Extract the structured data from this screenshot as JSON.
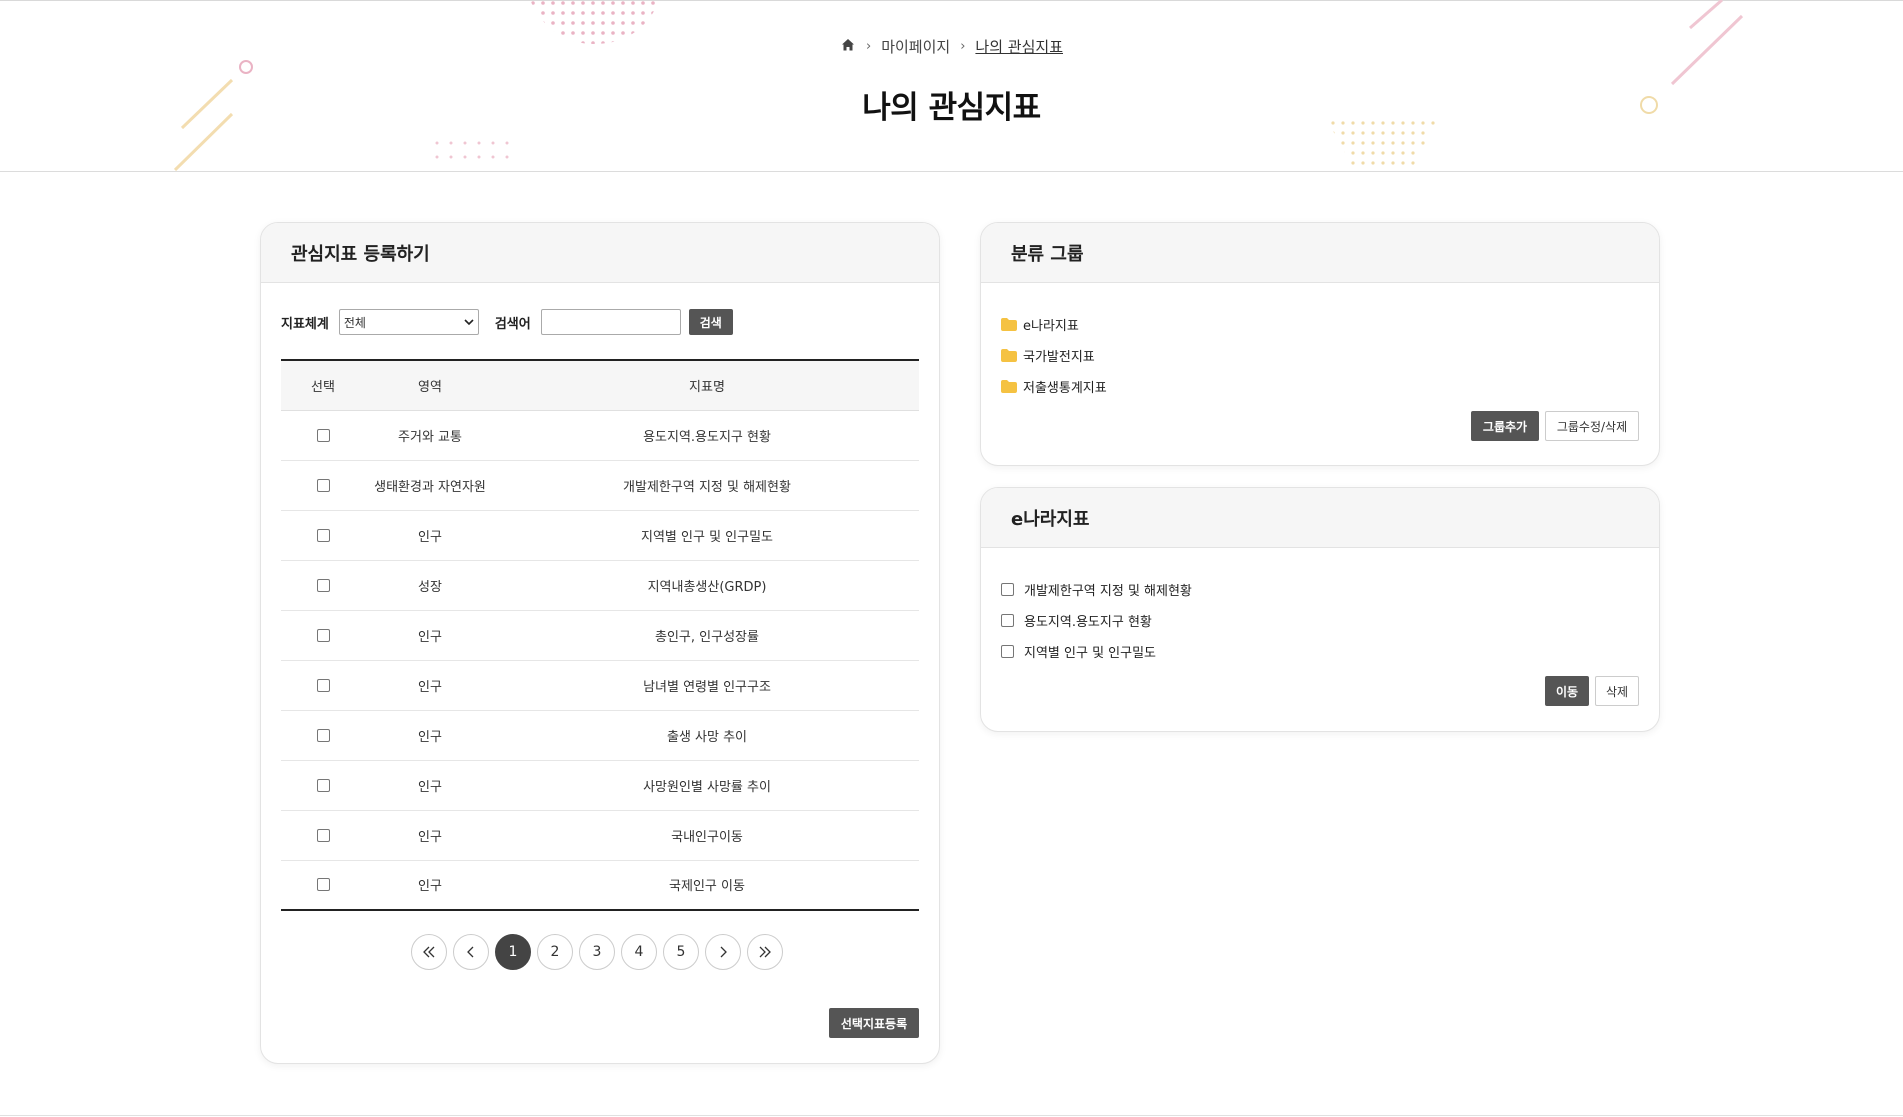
{
  "breadcrumb": {
    "items": [
      "마이페이지",
      "나의 관심지표"
    ]
  },
  "page": {
    "title": "나의 관심지표"
  },
  "register_panel": {
    "title": "관심지표 등록하기",
    "system_label": "지표체계",
    "system_value": "전체",
    "keyword_label": "검색어",
    "keyword_value": "",
    "search_button": "검색",
    "columns": [
      "선택",
      "영역",
      "지표명"
    ],
    "rows": [
      {
        "area": "주거와 교통",
        "name": "용도지역.용도지구 현황"
      },
      {
        "area": "생태환경과 자연자원",
        "name": "개발제한구역 지정 및 해제현황"
      },
      {
        "area": "인구",
        "name": "지역별 인구 및 인구밀도"
      },
      {
        "area": "성장",
        "name": "지역내총생산(GRDP)"
      },
      {
        "area": "인구",
        "name": "총인구, 인구성장률"
      },
      {
        "area": "인구",
        "name": "남녀별 연령별 인구구조"
      },
      {
        "area": "인구",
        "name": "출생 사망 추이"
      },
      {
        "area": "인구",
        "name": "사망원인별 사망률 추이"
      },
      {
        "area": "인구",
        "name": "국내인구이동"
      },
      {
        "area": "인구",
        "name": "국제인구 이동"
      }
    ],
    "pages": [
      "1",
      "2",
      "3",
      "4",
      "5"
    ],
    "current_page": "1",
    "register_button": "선택지표등록"
  },
  "group_panel": {
    "title": "분류 그룹",
    "groups": [
      "e나라지표",
      "국가발전지표",
      "저출생통계지표"
    ],
    "add_button": "그룹추가",
    "edit_button": "그룹수정/삭제"
  },
  "ena_panel": {
    "title": "e나라지표",
    "items": [
      "개발제한구역 지정 및 해제현황",
      "용도지역.용도지구 현황",
      "지역별 인구 및 인구밀도"
    ],
    "move_button": "이동",
    "delete_button": "삭제"
  },
  "colors": {
    "dark_button": "#555555",
    "active_page": "#444444",
    "folder": "#f5c242",
    "deco_pink": "#e8a5b8",
    "deco_yellow": "#f0d9a0"
  }
}
